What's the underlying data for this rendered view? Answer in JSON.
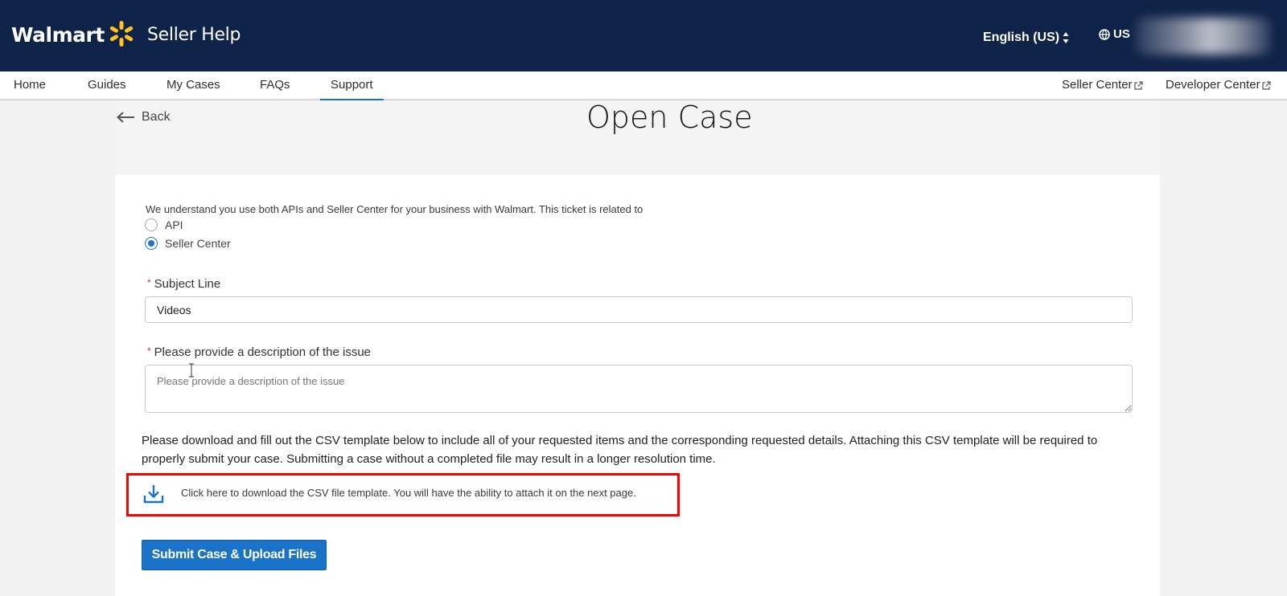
{
  "header": {
    "brand": "Walmart",
    "product": "Seller Help",
    "language": "English (US)",
    "region": "US",
    "icons": {
      "spark": "walmart-spark-logo",
      "globe": "globe-icon",
      "lang": "sort-arrows-icon"
    },
    "colors": {
      "header_bg": "#0f2247",
      "spark": "#ffc220"
    }
  },
  "nav": {
    "items": [
      {
        "label": "Home"
      },
      {
        "label": "Guides"
      },
      {
        "label": "My Cases"
      },
      {
        "label": "FAQs"
      },
      {
        "label": "Support",
        "active": true
      }
    ],
    "external": [
      {
        "label": "Seller Center"
      },
      {
        "label": "Developer Center"
      }
    ],
    "active_color": "#1a73c9"
  },
  "page": {
    "back_label": "Back",
    "title": "Open Case"
  },
  "form": {
    "intro": "We understand you use both APIs and Seller Center for your business with Walmart. This ticket is related to",
    "radios": [
      {
        "label": "API",
        "checked": false
      },
      {
        "label": "Seller Center",
        "checked": true
      }
    ],
    "subject": {
      "required_mark": "*",
      "label": "Subject Line",
      "value": "Videos"
    },
    "description": {
      "required_mark": "*",
      "label": "Please provide a description of the issue",
      "placeholder": "Please provide a description of the issue"
    },
    "instructions": "Please download and fill out the CSV template below to include all of your requested items and the corresponding requested details. Attaching this CSV template will be required to properly submit your case. Submitting a case without a completed file may result in a longer resolution time.",
    "download_text": "Click here to download the CSV file template. You will have the ability to attach it on the next page.",
    "submit_label": "Submit Case & Upload Files",
    "accent": "#1a73c9",
    "highlight_color": "#ff0000"
  }
}
